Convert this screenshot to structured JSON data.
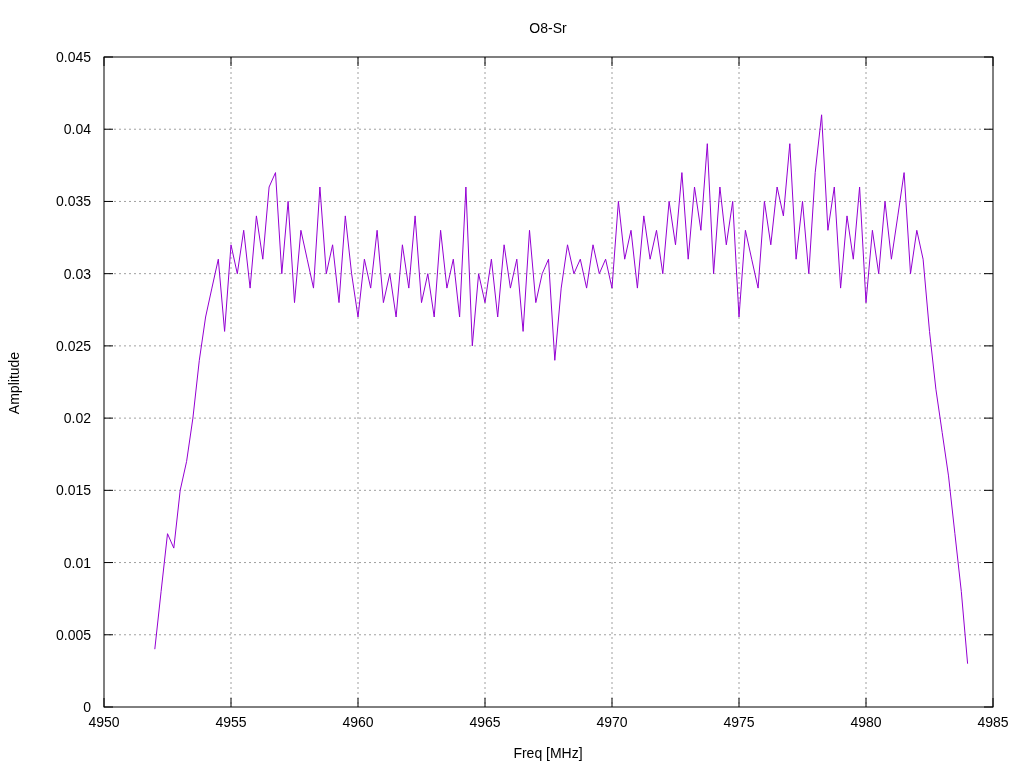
{
  "chart_data": {
    "type": "line",
    "title": "O8-Sr",
    "xlabel": "Freq [MHz]",
    "ylabel": "Amplitude",
    "grid": true,
    "xlim": [
      4950,
      4985
    ],
    "ylim": [
      0,
      0.045
    ],
    "xticks": [
      4950,
      4955,
      4960,
      4965,
      4970,
      4975,
      4980,
      4985
    ],
    "yticks": [
      0,
      0.005,
      0.01,
      0.015,
      0.02,
      0.025,
      0.03,
      0.035,
      0.04,
      0.045
    ],
    "x": [
      4952,
      4952.25,
      4952.5,
      4952.75,
      4953,
      4953.25,
      4953.5,
      4953.75,
      4954,
      4954.25,
      4954.5,
      4954.75,
      4955,
      4955.25,
      4955.5,
      4955.75,
      4956,
      4956.25,
      4956.5,
      4956.75,
      4957,
      4957.25,
      4957.5,
      4957.75,
      4958,
      4958.25,
      4958.5,
      4958.75,
      4959,
      4959.25,
      4959.5,
      4959.75,
      4960,
      4960.25,
      4960.5,
      4960.75,
      4961,
      4961.25,
      4961.5,
      4961.75,
      4962,
      4962.25,
      4962.5,
      4962.75,
      4963,
      4963.25,
      4963.5,
      4963.75,
      4964,
      4964.25,
      4964.5,
      4964.75,
      4965,
      4965.25,
      4965.5,
      4965.75,
      4966,
      4966.25,
      4966.5,
      4966.75,
      4967,
      4967.25,
      4967.5,
      4967.75,
      4968,
      4968.25,
      4968.5,
      4968.75,
      4969,
      4969.25,
      4969.5,
      4969.75,
      4970,
      4970.25,
      4970.5,
      4970.75,
      4971,
      4971.25,
      4971.5,
      4971.75,
      4972,
      4972.25,
      4972.5,
      4972.75,
      4973,
      4973.25,
      4973.5,
      4973.75,
      4974,
      4974.25,
      4974.5,
      4974.75,
      4975,
      4975.25,
      4975.5,
      4975.75,
      4976,
      4976.25,
      4976.5,
      4976.75,
      4977,
      4977.25,
      4977.5,
      4977.75,
      4978,
      4978.25,
      4978.5,
      4978.75,
      4979,
      4979.25,
      4979.5,
      4979.75,
      4980,
      4980.25,
      4980.5,
      4980.75,
      4981,
      4981.25,
      4981.5,
      4981.75,
      4982,
      4982.25,
      4982.5,
      4982.75,
      4983,
      4983.25,
      4983.5,
      4983.75,
      4984
    ],
    "series": [
      {
        "color": "#9400d3",
        "values": [
          0.004,
          0.008,
          0.012,
          0.011,
          0.015,
          0.017,
          0.02,
          0.024,
          0.027,
          0.029,
          0.031,
          0.026,
          0.032,
          0.03,
          0.033,
          0.029,
          0.034,
          0.031,
          0.036,
          0.037,
          0.03,
          0.035,
          0.028,
          0.033,
          0.031,
          0.029,
          0.036,
          0.03,
          0.032,
          0.028,
          0.034,
          0.03,
          0.027,
          0.031,
          0.029,
          0.033,
          0.028,
          0.03,
          0.027,
          0.032,
          0.029,
          0.034,
          0.028,
          0.03,
          0.027,
          0.033,
          0.029,
          0.031,
          0.027,
          0.036,
          0.025,
          0.03,
          0.028,
          0.031,
          0.027,
          0.032,
          0.029,
          0.031,
          0.026,
          0.033,
          0.028,
          0.03,
          0.031,
          0.024,
          0.029,
          0.032,
          0.03,
          0.031,
          0.029,
          0.032,
          0.03,
          0.031,
          0.029,
          0.035,
          0.031,
          0.033,
          0.029,
          0.034,
          0.031,
          0.033,
          0.03,
          0.035,
          0.032,
          0.037,
          0.031,
          0.036,
          0.033,
          0.039,
          0.03,
          0.036,
          0.032,
          0.035,
          0.027,
          0.033,
          0.031,
          0.029,
          0.035,
          0.032,
          0.036,
          0.034,
          0.039,
          0.031,
          0.035,
          0.03,
          0.037,
          0.041,
          0.033,
          0.036,
          0.029,
          0.034,
          0.031,
          0.036,
          0.028,
          0.033,
          0.03,
          0.035,
          0.031,
          0.034,
          0.037,
          0.03,
          0.033,
          0.031,
          0.026,
          0.022,
          0.019,
          0.016,
          0.012,
          0.008,
          0.003
        ]
      }
    ]
  }
}
